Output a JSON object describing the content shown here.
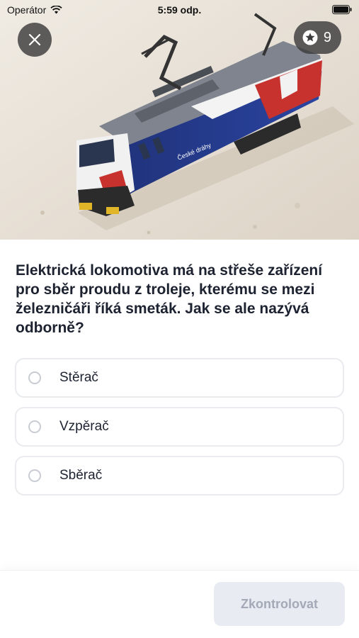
{
  "status_bar": {
    "carrier": "Operátor",
    "time": "5:59 odp."
  },
  "header": {
    "close_icon": "close-icon",
    "stars_icon": "star-circle-icon",
    "stars_count": "9"
  },
  "hero_image": {
    "subject": "model electric locomotive",
    "livery_text": "České dráhy",
    "colors": {
      "body_blue": "#233a87",
      "roof_grey": "#8b8f98",
      "accent_red": "#c8322e",
      "accent_white": "#f2f2f2",
      "bumper_yellow": "#e0b528"
    }
  },
  "question": {
    "text": "Elektrická lokomotiva má na střeše zařízení pro sběr proudu z troleje, kterému se mezi železničáři říká smeták. Jak se ale nazývá odborně?"
  },
  "answers": [
    {
      "label": "Stěrač"
    },
    {
      "label": "Vzpěrač"
    },
    {
      "label": "Sběrač"
    }
  ],
  "footer": {
    "check_button_label": "Zkontrolovat"
  },
  "colors": {
    "text_primary": "#1d2230",
    "answer_border": "#e9ebef",
    "button_disabled_bg": "#e8ebf1",
    "button_disabled_text": "#a3a9b6",
    "overlay_button_bg": "#3c3c3c"
  }
}
